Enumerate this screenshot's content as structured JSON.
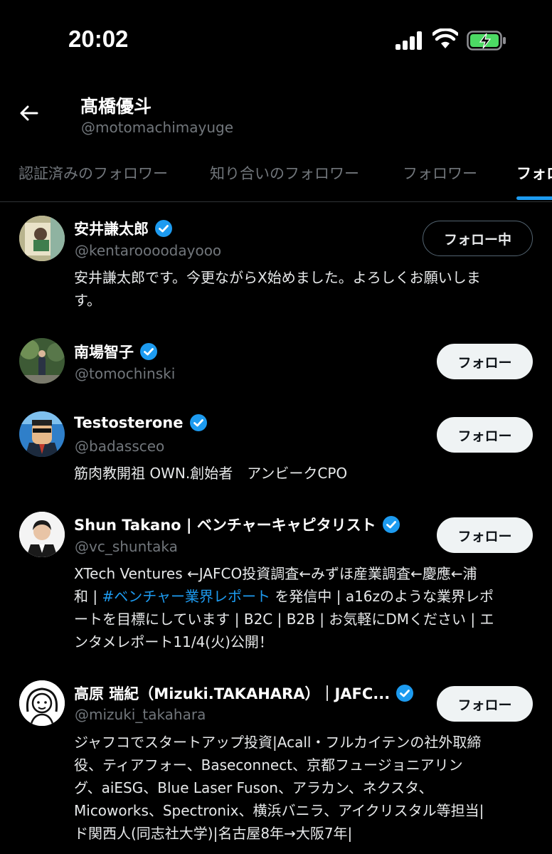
{
  "status_bar": {
    "time": "20:02"
  },
  "header": {
    "name": "髙橋優斗",
    "handle": "@motomachimayuge"
  },
  "tabs": [
    {
      "label": "認証済みのフォロワー",
      "active": false
    },
    {
      "label": "知り合いのフォロワー",
      "active": false
    },
    {
      "label": "フォロワー",
      "active": false
    },
    {
      "label": "フォロー",
      "active": true
    }
  ],
  "colors": {
    "accent": "#1d9bf0",
    "muted": "#71767b",
    "background": "#000000"
  },
  "users": [
    {
      "name": "安井謙太郎",
      "handle": "@kentaroooodayooo",
      "verified": true,
      "button": "フォロー中",
      "bio_lines": [
        "安井謙太郎です。今更ながらX始めました。よろしくお願いしま",
        "す。"
      ]
    },
    {
      "name": "南場智子",
      "handle": "@tomochinski",
      "verified": true,
      "button": "フォロー",
      "bio_lines": []
    },
    {
      "name": "Testosterone",
      "handle": "@badassceo",
      "verified": true,
      "button": "フォロー",
      "bio_lines": [
        "筋肉教開祖 OWN.創始者　アンビークCPO"
      ]
    },
    {
      "name": "Shun Takano | ベンチャーキャピタリスト",
      "handle": "@vc_shuntaka",
      "verified": true,
      "button": "フォロー",
      "bio_line1": "XTech Ventures ←JAFCO投資調査←みずほ産業調査←慶應←浦",
      "bio_line2_pre": "和 | ",
      "bio_line2_link": "#ベンチャー業界レポート",
      "bio_line2_post": " を発信中 | a16zのような業界レポ",
      "bio_line3": "ートを目標にしています | B2C | B2B | お気軽にDMください | エ",
      "bio_line4": "ンタメレポート11/4(火)公開！"
    },
    {
      "name": "高原 瑞紀（Mizuki.TAKAHARA）｜JAFC...",
      "handle": "@mizuki_takahara",
      "verified": true,
      "button": "フォロー",
      "bio_lines": [
        "ジャフコでスタートアップ投資|Acall・フルカイテンの社外取締",
        "役、ティアフォー、Baseconnect、京都フュージョニアリン",
        "グ、aiESG、Blue Laser Fuson、アラカン、ネクスタ、",
        "Micoworks、Spectronix、横浜バニラ、アイクリスタル等担当|",
        "ド関西人(同志社大学)|名古屋8年→大阪7年|"
      ]
    }
  ]
}
